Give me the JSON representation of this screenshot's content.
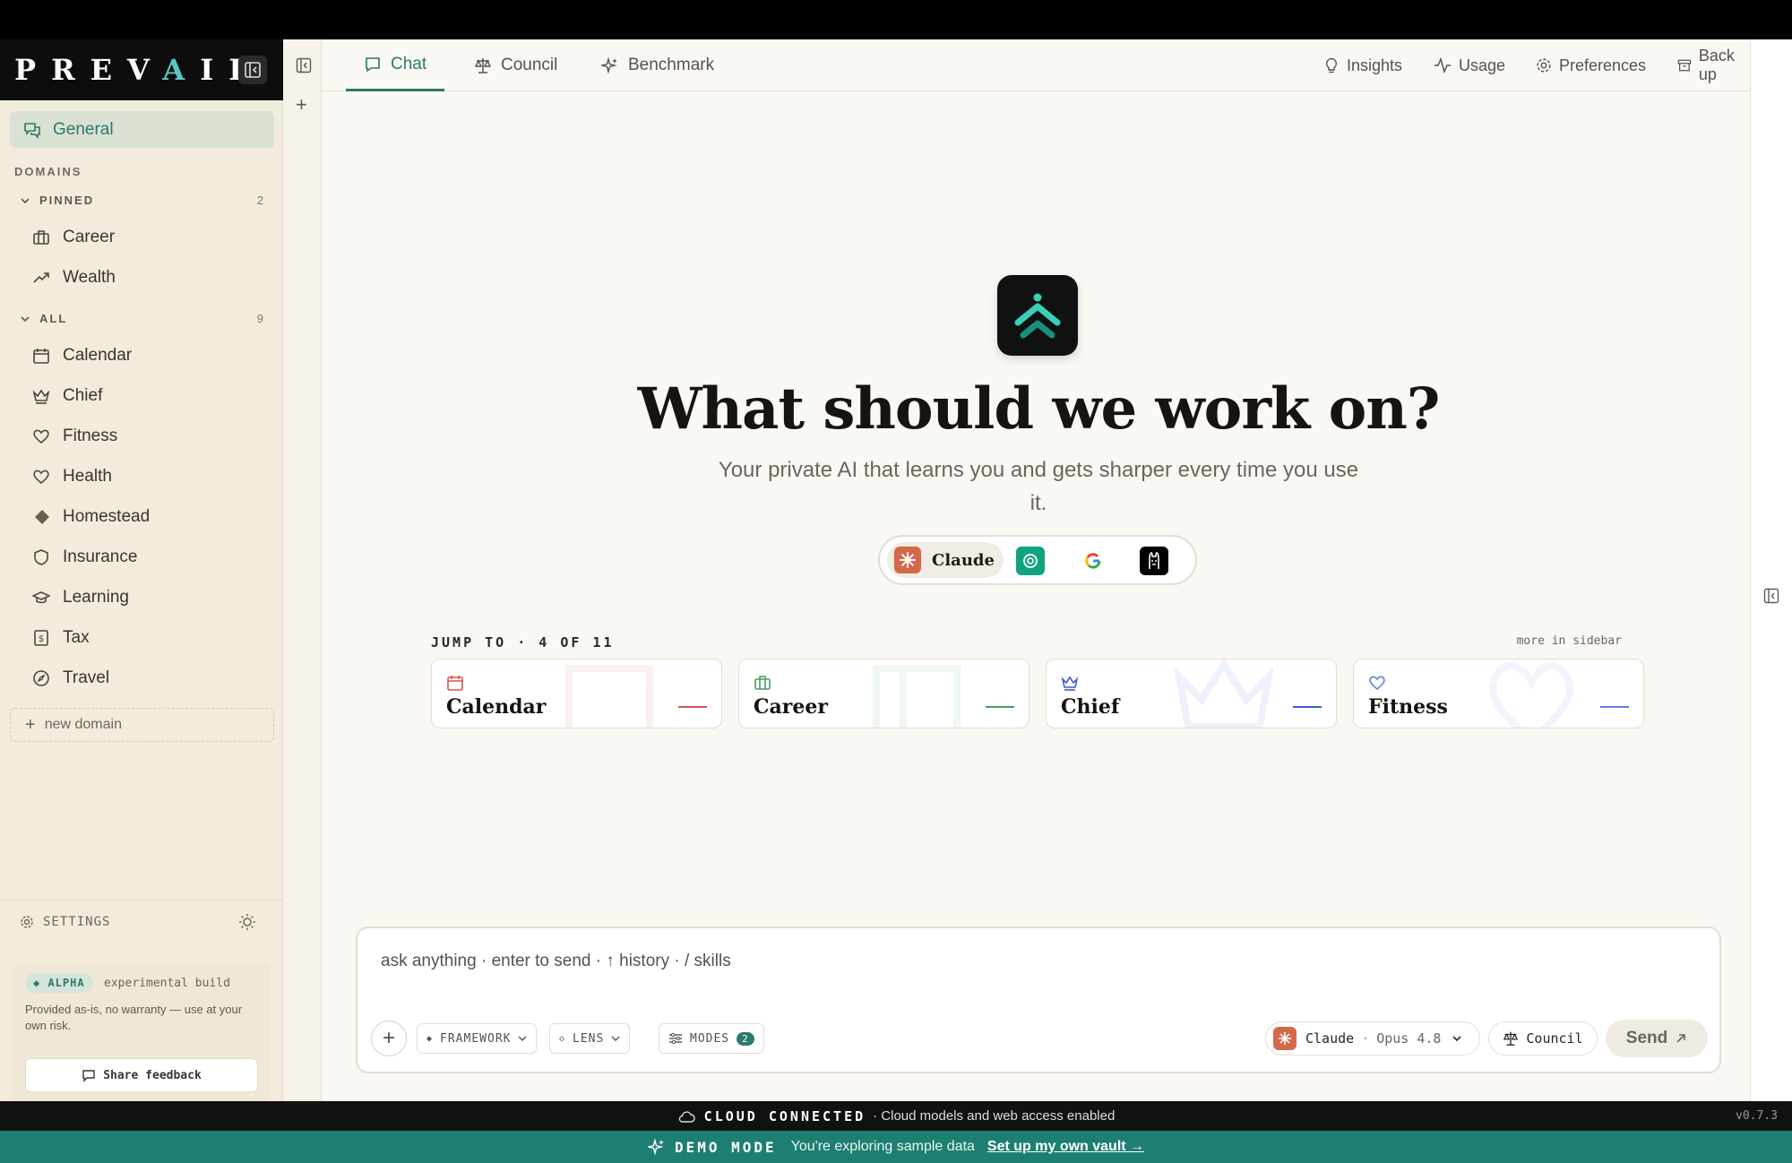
{
  "brand": {
    "prefix": "PREV",
    "accent": "A",
    "suffix": "IL"
  },
  "sidebar": {
    "general_label": "General",
    "domains_label": "DOMAINS",
    "pinned": {
      "label": "PINNED",
      "count": "2",
      "items": [
        "Career",
        "Wealth"
      ]
    },
    "all": {
      "label": "ALL",
      "count": "9",
      "items": [
        "Calendar",
        "Chief",
        "Fitness",
        "Health",
        "Homestead",
        "Insurance",
        "Learning",
        "Tax",
        "Travel"
      ]
    },
    "new_domain": "new domain",
    "settings_label": "SETTINGS",
    "alpha": {
      "badge": "ALPHA",
      "subtitle": "experimental build",
      "desc": "Provided as-is, no warranty — use at your own risk.",
      "feedback": "Share feedback"
    }
  },
  "tabs": {
    "chat": "Chat",
    "council": "Council",
    "benchmark": "Benchmark"
  },
  "top_actions": {
    "insights": "Insights",
    "usage": "Usage",
    "preferences": "Preferences",
    "backup": "Back up"
  },
  "hero": {
    "title": "What should we work on?",
    "subtitle": "Your private AI that learns you and gets sharper every time you use it."
  },
  "models": {
    "active": "Claude"
  },
  "jump": {
    "label": "JUMP TO · 4 OF 11",
    "more": "more in sidebar",
    "cards": [
      {
        "name": "Calendar",
        "color": "#d9534f"
      },
      {
        "name": "Career",
        "color": "#4e9a63"
      },
      {
        "name": "Chief",
        "color": "#3b5bd6"
      },
      {
        "name": "Fitness",
        "color": "#6a78e0"
      }
    ]
  },
  "composer": {
    "placeholder": "ask anything · enter to send · ↑ history · / skills",
    "framework": "FRAMEWORK",
    "lens": "LENS",
    "modes": "MODES",
    "modes_count": "2",
    "model_name": "Claude",
    "model_version": "Opus 4.8",
    "council": "Council",
    "send": "Send"
  },
  "status": {
    "cloud_title": "CLOUD CONNECTED",
    "cloud_desc": "· Cloud models and web access enabled",
    "version": "v0.7.3",
    "demo_title": "DEMO MODE",
    "demo_desc": "You're exploring sample data",
    "demo_link": "Set up my own vault →"
  },
  "colors": {
    "accent": "#2b7a6d",
    "brand_accent": "#5bc8c0",
    "claude": "#d4694a"
  }
}
